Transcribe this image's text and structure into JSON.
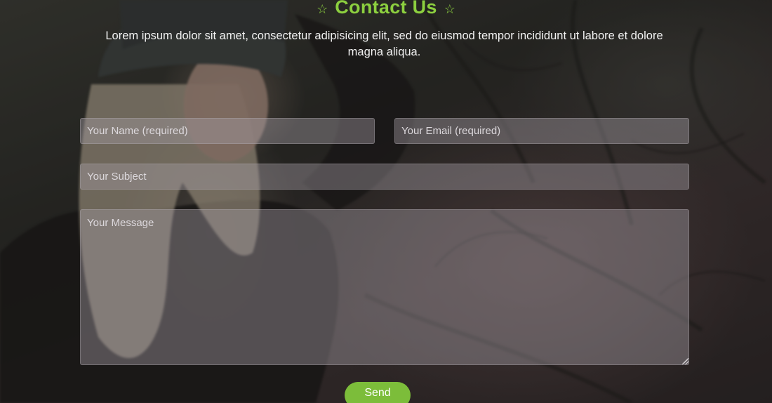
{
  "header": {
    "title": "Contact Us",
    "subtitle": "Lorem ipsum dolor sit amet, consectetur adipisicing elit, sed do eiusmod tempor incididunt ut labore et dolore magna aliqua."
  },
  "form": {
    "name_placeholder": "Your Name (required)",
    "email_placeholder": "Your Email (required)",
    "subject_placeholder": "Your Subject",
    "message_placeholder": "Your Message",
    "send_label": "Send"
  },
  "icons": {
    "left_star": "star-outline-icon",
    "right_star": "star-outline-icon"
  },
  "colors": {
    "accent": "#8ccf3f",
    "button": "#7cbd3a",
    "text": "#f2f2f2"
  }
}
